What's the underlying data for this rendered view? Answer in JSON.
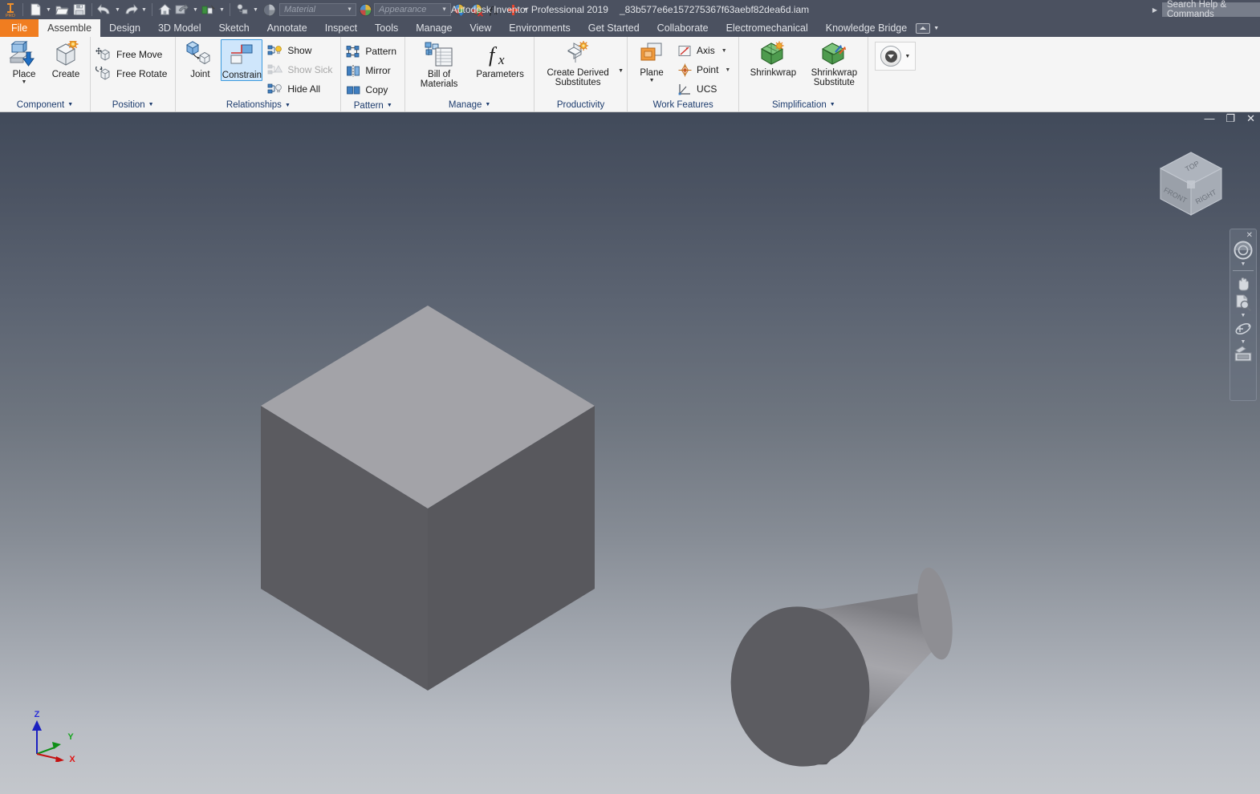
{
  "window": {
    "title": "Autodesk Inventor Professional 2019",
    "filename": "_83b577e6e157275367f63aebf82dea6d.iam",
    "controls": {
      "minimize": "—",
      "restore": "❐",
      "close": "✕"
    }
  },
  "quick_access": {
    "items": [
      {
        "name": "inventor-pro-logo-icon",
        "label": "PRO"
      },
      {
        "name": "new-file-icon",
        "label": "New"
      },
      {
        "name": "open-file-icon",
        "label": "Open"
      },
      {
        "name": "save-icon",
        "label": "Save"
      },
      {
        "name": "undo-icon",
        "label": "Undo"
      },
      {
        "name": "redo-icon",
        "label": "Redo"
      },
      {
        "name": "home-icon",
        "label": "Home"
      },
      {
        "name": "return-icon",
        "label": "Return"
      },
      {
        "name": "update-icon",
        "label": "Update"
      },
      {
        "name": "select-icon",
        "label": "Select"
      },
      {
        "name": "appearance-sphere-icon",
        "label": "Appearance"
      }
    ],
    "material_placeholder": "Material",
    "appearance_placeholder": "Appearance",
    "adjust_label": "Adjust",
    "clear_label": "Clear",
    "fx_label": "fx",
    "add_label": "+",
    "more_label": "More"
  },
  "search": {
    "placeholder": "Search Help & Commands",
    "caret": "▶"
  },
  "tabs": [
    {
      "label": "File",
      "state": "file"
    },
    {
      "label": "Assemble",
      "state": "active"
    },
    {
      "label": "Design",
      "state": ""
    },
    {
      "label": "3D Model",
      "state": ""
    },
    {
      "label": "Sketch",
      "state": ""
    },
    {
      "label": "Annotate",
      "state": ""
    },
    {
      "label": "Inspect",
      "state": ""
    },
    {
      "label": "Tools",
      "state": ""
    },
    {
      "label": "Manage",
      "state": ""
    },
    {
      "label": "View",
      "state": ""
    },
    {
      "label": "Environments",
      "state": ""
    },
    {
      "label": "Get Started",
      "state": ""
    },
    {
      "label": "Collaborate",
      "state": ""
    },
    {
      "label": "Electromechanical",
      "state": ""
    },
    {
      "label": "Knowledge Bridge",
      "state": ""
    }
  ],
  "ribbon": {
    "component": {
      "title": "Component",
      "arrow": "▼",
      "place": "Place",
      "place_drop": "▼",
      "create": "Create"
    },
    "position": {
      "title": "Position",
      "arrow": "▼",
      "free_move": "Free Move",
      "free_rotate": "Free Rotate"
    },
    "relationships": {
      "title": "Relationships",
      "arrow": "▼",
      "joint": "Joint",
      "constrain": "Constrain",
      "show": "Show",
      "show_sick": "Show Sick",
      "hide_all": "Hide All"
    },
    "pattern": {
      "title": "Pattern",
      "arrow": "▼",
      "pattern": "Pattern",
      "mirror": "Mirror",
      "copy": "Copy"
    },
    "manage": {
      "title": "Manage",
      "arrow": "▼",
      "bom": "Bill of\nMaterials",
      "bom_line1": "Bill of",
      "bom_line2": "Materials",
      "parameters": "Parameters"
    },
    "productivity": {
      "title": "Productivity",
      "derived_line1": "Create Derived",
      "derived_line2": "Substitutes",
      "derived_drop": "▼"
    },
    "work_features": {
      "title": "Work Features",
      "plane": "Plane",
      "plane_drop": "▼",
      "axis": "Axis",
      "axis_drop": "▼",
      "point": "Point",
      "point_drop": "▼",
      "ucs": "UCS"
    },
    "simplification": {
      "title": "Simplification",
      "arrow": "▼",
      "shrinkwrap": "Shrinkwrap",
      "shrinkwrap_sub_line1": "Shrinkwrap",
      "shrinkwrap_sub_line2": "Substitute"
    },
    "overflow": {
      "label": "More",
      "arrow": "▼"
    }
  },
  "viewcube": {
    "top": "TOP",
    "front": "FRONT",
    "right": "RIGHT"
  },
  "navbar": {
    "close": "✕",
    "items": [
      {
        "name": "steering-wheel-icon",
        "label": "Full Navigation Wheel"
      },
      {
        "name": "pan-hand-icon",
        "label": "Pan"
      },
      {
        "name": "zoom-icon",
        "label": "Zoom"
      },
      {
        "name": "orbit-icon",
        "label": "Orbit"
      },
      {
        "name": "look-camera-icon",
        "label": "Look At"
      }
    ]
  },
  "triad": {
    "x": "X",
    "y": "Y",
    "z": "Z"
  },
  "scene": {
    "objects": [
      {
        "name": "cube",
        "type": "box"
      },
      {
        "name": "cone",
        "type": "truncated-cone"
      }
    ],
    "colors": {
      "bg_top": "#414a5a",
      "bg_bottom": "#c4c7cc",
      "solid_light": "#a0a0a5",
      "solid_dark": "#5a5a5f",
      "accent_orange": "#f07d20",
      "selection_blue": "#cfe6fb"
    }
  }
}
